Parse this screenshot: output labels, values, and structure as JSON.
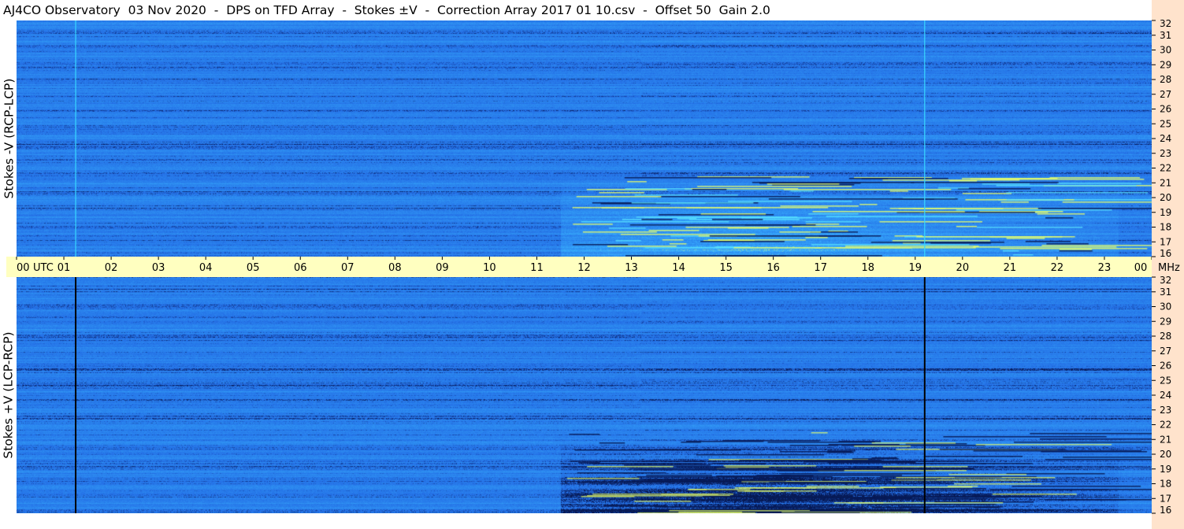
{
  "title": "AJ4CO Observatory  03 Nov 2020  -  DPS on TFD Array  -  Stokes ±V  -  Correction Array 2017 01 10.csv  -  Offset 50  Gain 2.0",
  "colors": {
    "background": "#ffffff",
    "time_bar": "#ffffc0",
    "freq_axis_bg": "#ffe3cc",
    "spectrogram_base": "#1f5fe0",
    "spectrogram_bright": "#39b3ff",
    "burst_hot": "#e7ff6a",
    "burst_dark": "#071a55",
    "marker_top": "#38d8ff",
    "marker_bottom": "#000000"
  },
  "chart_data": [
    {
      "type": "heatmap",
      "title": "",
      "ylabel": "Stokes -V (RCP-LCP)",
      "xlabel": "UTC",
      "xlim": [
        0,
        24
      ],
      "ylim": [
        16,
        32
      ],
      "y_unit": "MHz",
      "x_ticks": [
        "00",
        "01",
        "02",
        "03",
        "04",
        "05",
        "06",
        "07",
        "08",
        "09",
        "10",
        "11",
        "12",
        "13",
        "14",
        "15",
        "16",
        "17",
        "18",
        "19",
        "20",
        "21",
        "22",
        "23",
        "00"
      ],
      "y_ticks": [
        16,
        17,
        18,
        19,
        20,
        21,
        22,
        23,
        24,
        25,
        26,
        27,
        28,
        29,
        30,
        31,
        32
      ],
      "vertical_markers_utc": [
        1.25,
        19.2
      ],
      "marker_color": "#38d8ff",
      "activity": [
        {
          "name": "",
          "start_utc": 11.5,
          "end_utc": 23.3,
          "freq_min_mhz": 16,
          "freq_max_mhz": 21.5,
          "sign": "positive"
        }
      ]
    },
    {
      "type": "heatmap",
      "title": "",
      "ylabel": "Stokes +V (LCP-RCP)",
      "xlabel": "UTC",
      "xlim": [
        0,
        24
      ],
      "ylim": [
        16,
        32
      ],
      "y_unit": "MHz",
      "x_ticks": [
        "00",
        "01",
        "02",
        "03",
        "04",
        "05",
        "06",
        "07",
        "08",
        "09",
        "10",
        "11",
        "12",
        "13",
        "14",
        "15",
        "16",
        "17",
        "18",
        "19",
        "20",
        "21",
        "22",
        "23",
        "00"
      ],
      "y_ticks": [
        16,
        17,
        18,
        19,
        20,
        21,
        22,
        23,
        24,
        25,
        26,
        27,
        28,
        29,
        30,
        31,
        32
      ],
      "vertical_markers_utc": [
        1.25,
        19.2
      ],
      "marker_color": "#000000",
      "activity": [
        {
          "name": "",
          "start_utc": 11.5,
          "end_utc": 23.3,
          "freq_min_mhz": 16,
          "freq_max_mhz": 21.5,
          "sign": "negative"
        }
      ]
    }
  ],
  "time_axis": {
    "labels": [
      "00",
      "01",
      "02",
      "03",
      "04",
      "05",
      "06",
      "07",
      "08",
      "09",
      "10",
      "11",
      "12",
      "13",
      "14",
      "15",
      "16",
      "17",
      "18",
      "19",
      "20",
      "21",
      "22",
      "23",
      "00"
    ],
    "unit": "UTC",
    "freq_unit": "MHz"
  }
}
